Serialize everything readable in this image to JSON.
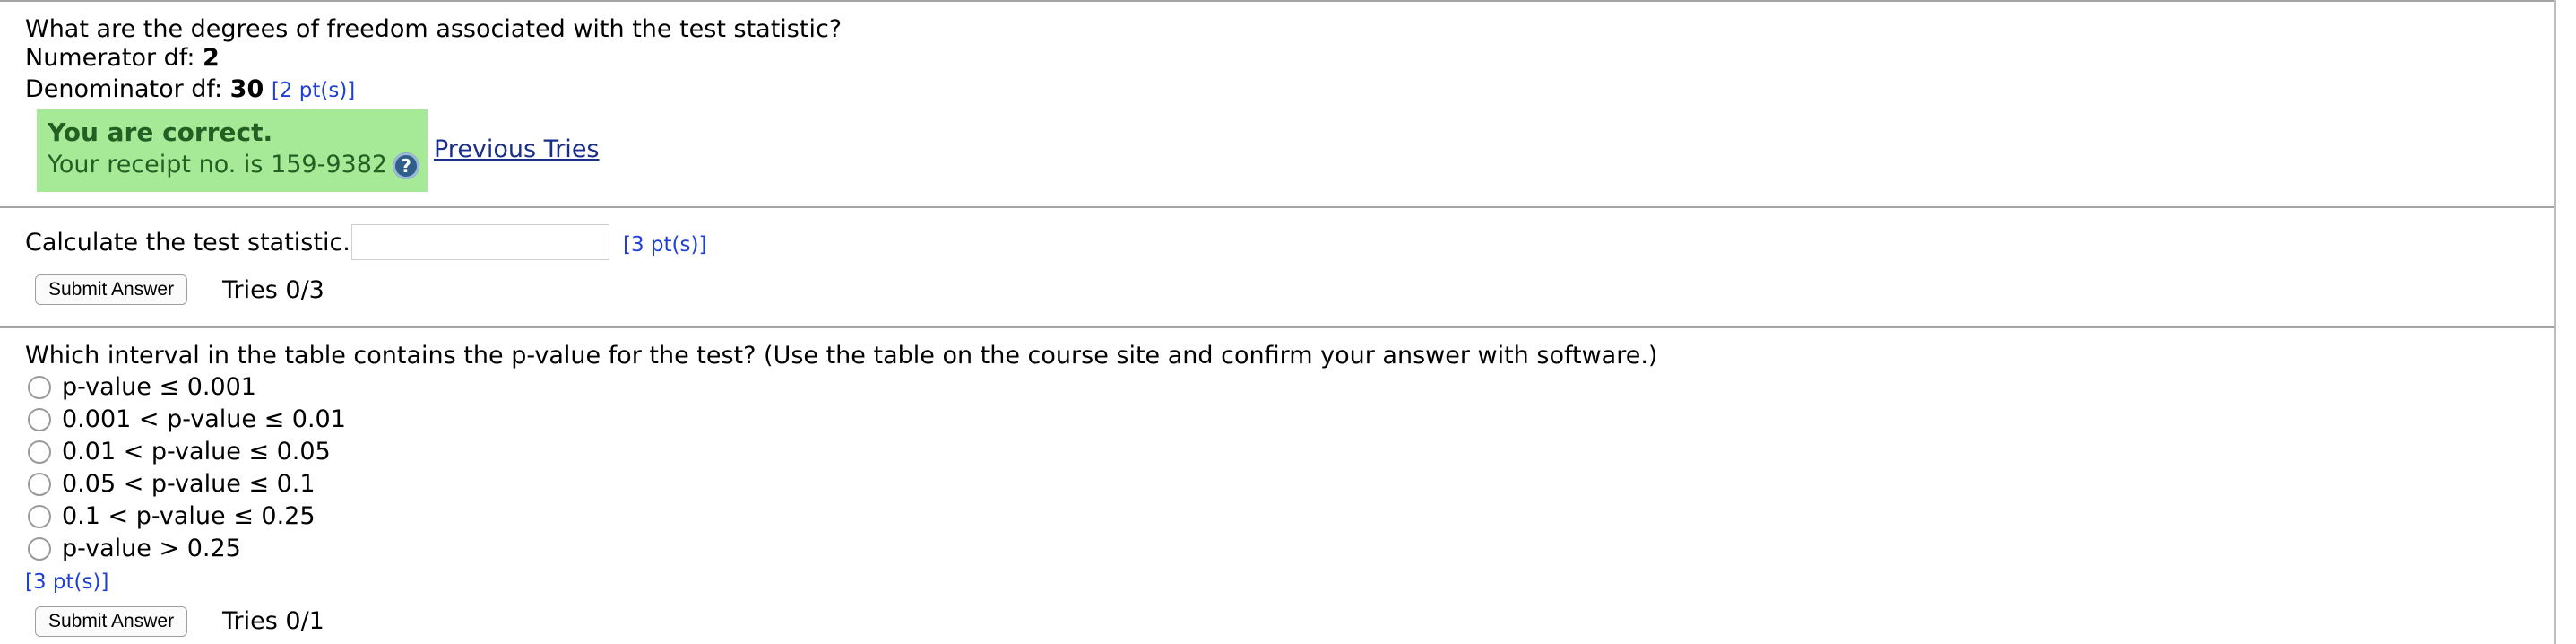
{
  "q1": {
    "question": "What are the degrees of freedom associated with the test statistic?",
    "numerator_label": "Numerator df:",
    "numerator_value": "2",
    "denominator_label": "Denominator df:",
    "denominator_value": "30",
    "points": "[2 pt(s)]",
    "feedback_title": "You are correct.",
    "feedback_receipt": "Your receipt no. is 159-9382",
    "help_icon": "?",
    "previous_tries": "Previous Tries"
  },
  "q2": {
    "question": "Calculate the test statistic.",
    "input_value": "",
    "points": "[3 pt(s)]",
    "submit_label": "Submit Answer",
    "tries": "Tries 0/3"
  },
  "q3": {
    "question": "Which interval in the table contains the p-value for the test? (Use the table on the course site and confirm your answer with software.)",
    "options": [
      "p-value ≤ 0.001",
      "0.001 < p-value ≤ 0.01",
      "0.01 < p-value ≤ 0.05",
      "0.05 < p-value ≤ 0.1",
      "0.1 < p-value ≤ 0.25",
      "p-value > 0.25"
    ],
    "points": "[3 pt(s)]",
    "submit_label": "Submit Answer",
    "tries": "Tries 0/1"
  }
}
